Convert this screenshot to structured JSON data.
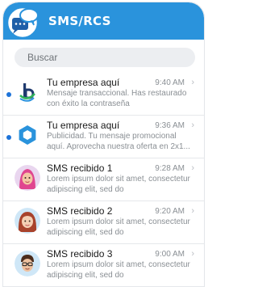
{
  "header": {
    "title": "SMS/RCS",
    "icon": "chat-bubbles-icon"
  },
  "search": {
    "placeholder": "Buscar"
  },
  "messages": [
    {
      "sender": "Tu empresa aquí",
      "time": "9:40 AM",
      "preview": "Mensaje transaccional. Has restaurado con éxito la contraseña",
      "unread": true,
      "avatar": "brand-b-logo"
    },
    {
      "sender": "Tu empresa aquí",
      "time": "9:36 AM",
      "preview": "Publicidad. Tu mensaje promocional aquí. Aprovecha nuestra oferta en 2x1...",
      "unread": true,
      "avatar": "brand-hexagon-logo"
    },
    {
      "sender": "SMS recibido 1",
      "time": "9:28 AM",
      "preview": "Lorem ipsum dolor sit amet, consectetur adipiscing elit, sed do",
      "unread": false,
      "avatar": "memoji-woman-hijab"
    },
    {
      "sender": "SMS recibido 2",
      "time": "9:20 AM",
      "preview": "Lorem ipsum dolor sit amet, consectetur adipiscing elit, sed do",
      "unread": false,
      "avatar": "memoji-woman-red-hair"
    },
    {
      "sender": "SMS recibido 3",
      "time": "9:00 AM",
      "preview": "Lorem ipsum dolor sit amet, consectetur adipiscing elit, sed do",
      "unread": false,
      "avatar": "memoji-man-glasses"
    }
  ],
  "colors": {
    "header": "#2a93dc",
    "unread_dot": "#1d73d9"
  }
}
